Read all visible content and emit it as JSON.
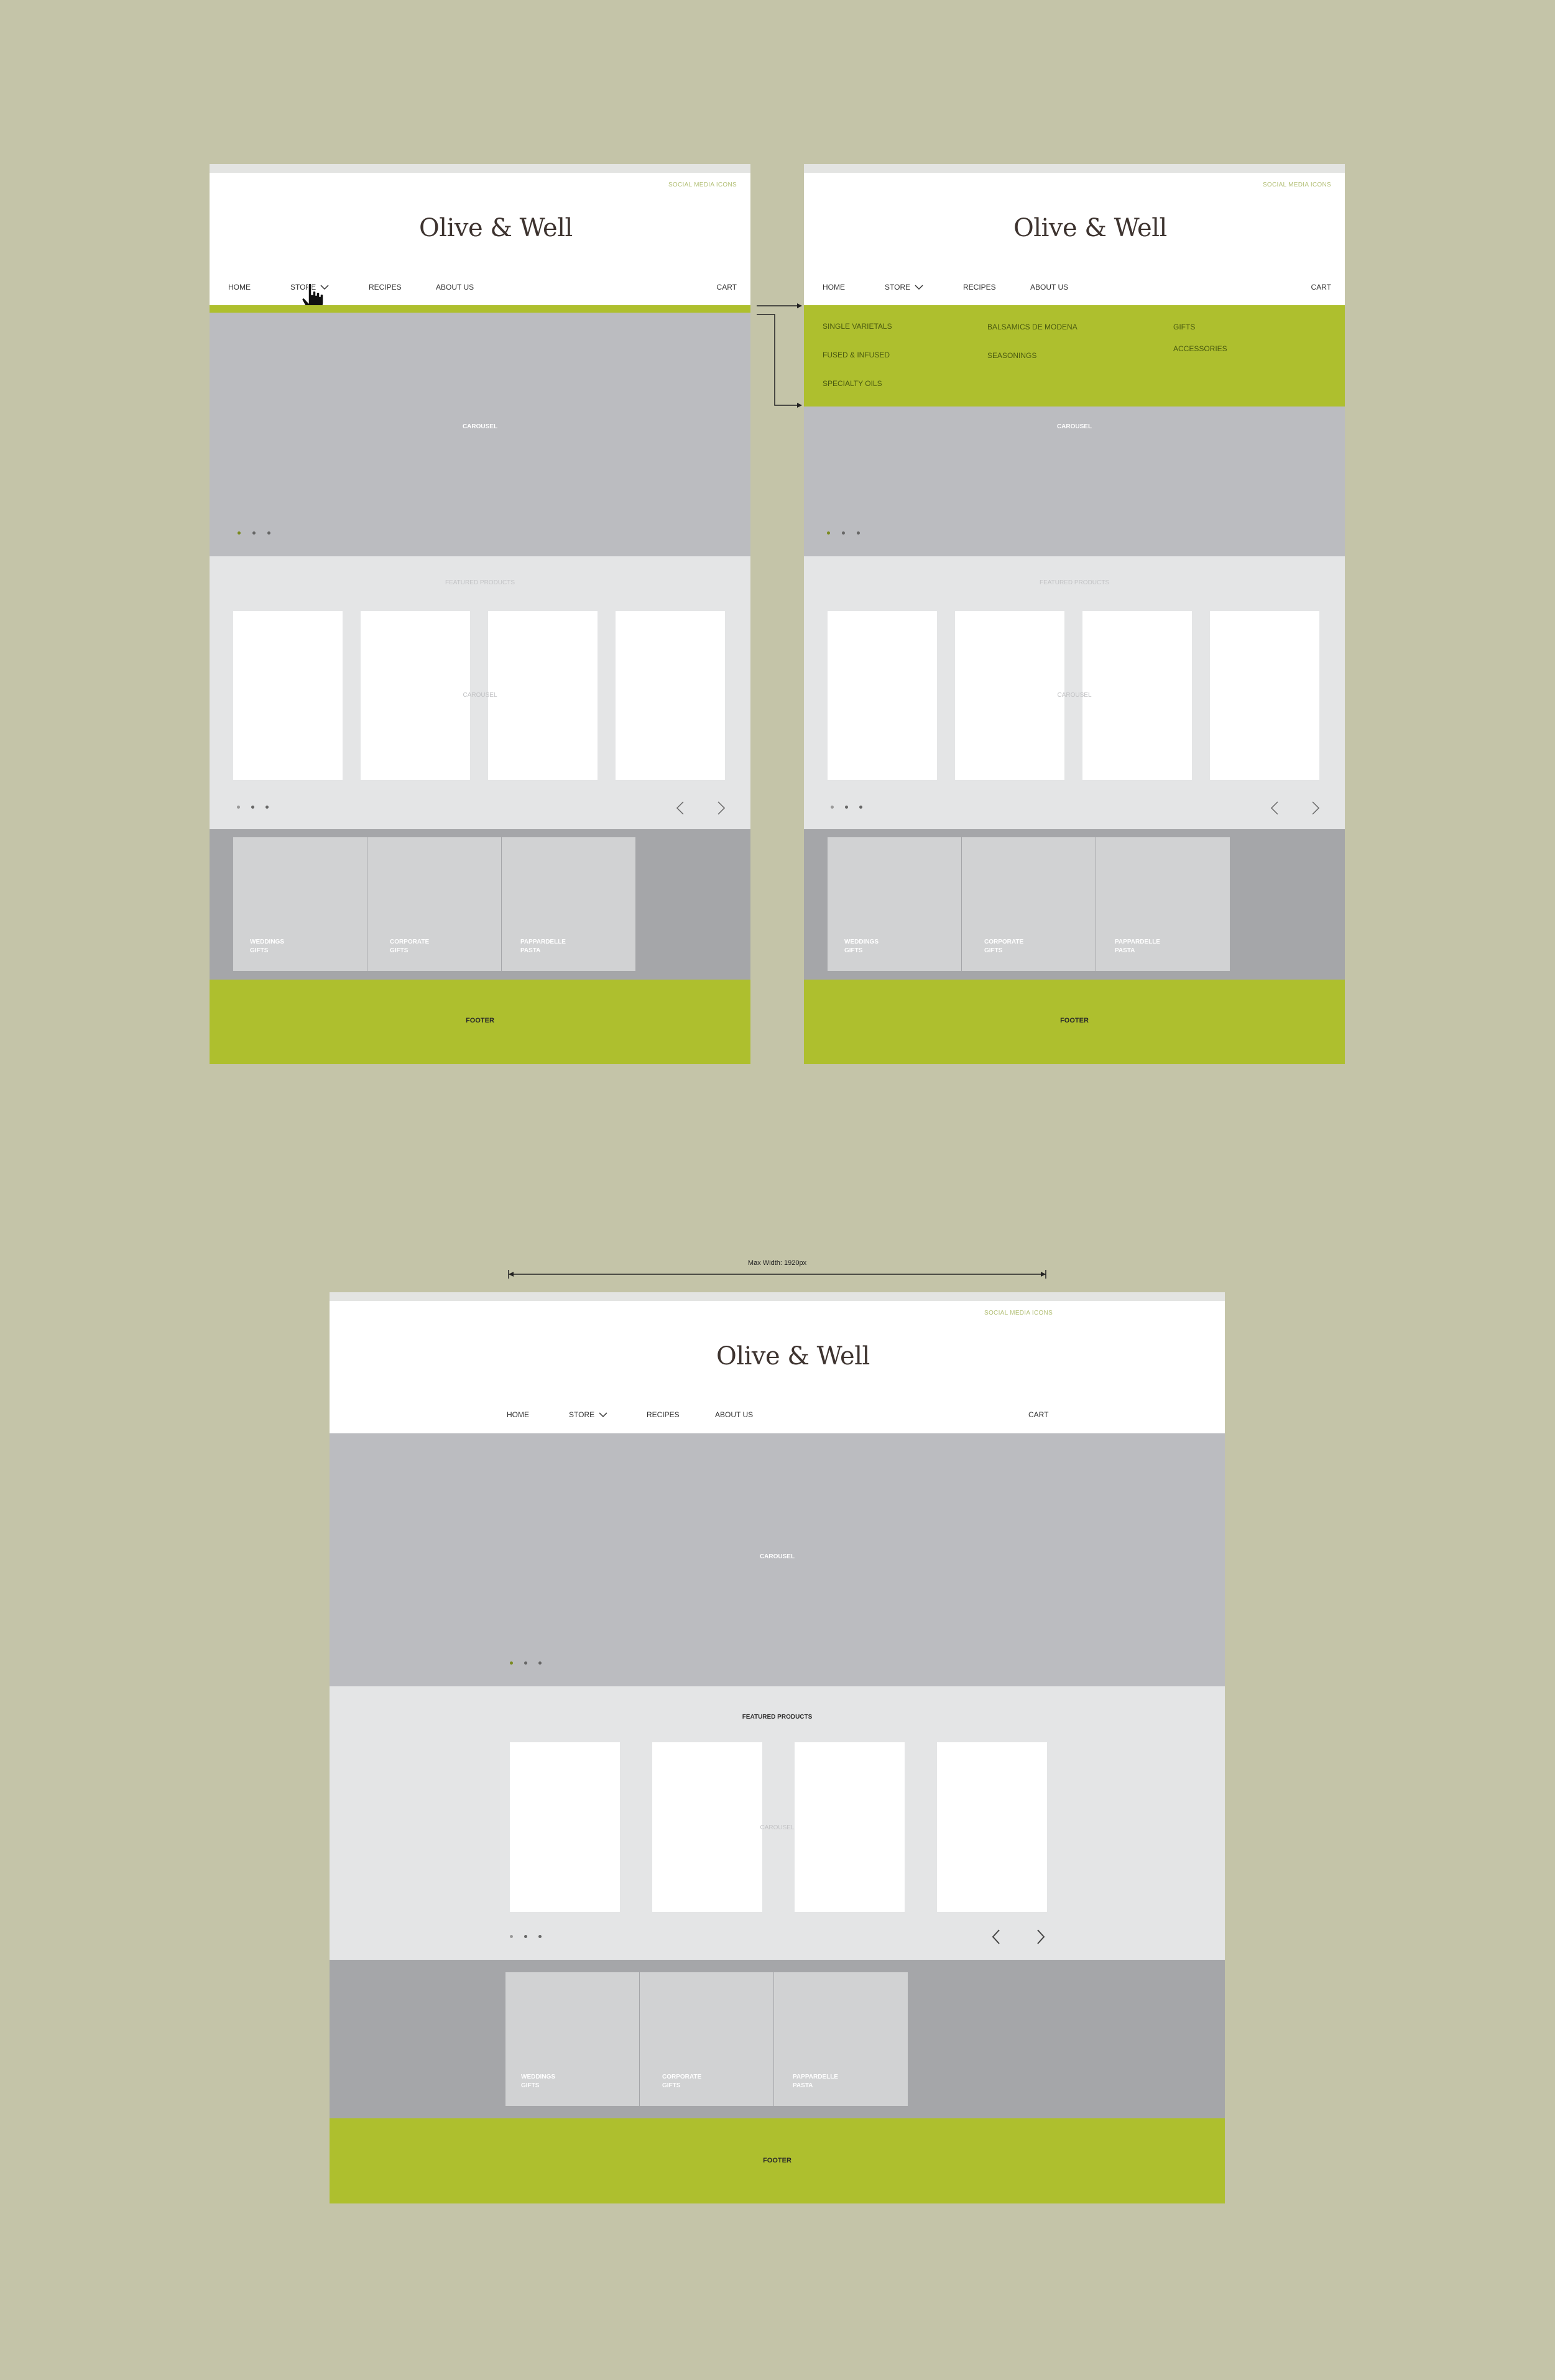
{
  "brand": "Olive & Well",
  "social_label": "SOCIAL MEDIA ICONS",
  "nav": {
    "home": "HOME",
    "store": "STORE",
    "recipes": "RECIPES",
    "about": "ABOUT US",
    "cart": "CART"
  },
  "dropdown": {
    "col1": [
      "SINGLE VARIETALS",
      "FUSED & INFUSED",
      "SPECIALTY OILS"
    ],
    "col2": [
      "BALSAMICS DE MODENA",
      "SEASONINGS"
    ],
    "col3": [
      "GIFTS",
      "ACCESSORIES"
    ]
  },
  "hero_label": "CAROUSEL",
  "featured_title": "FEATURED PRODUCTS",
  "products_carousel_label": "CAROUSEL",
  "gift_tiles": [
    {
      "line1": "WEDDINGS",
      "line2": "GIFTS"
    },
    {
      "line1": "CORPORATE",
      "line2": "GIFTS"
    },
    {
      "line1": "PAPPARDELLE",
      "line2": "PASTA"
    }
  ],
  "footer_label": "FOOTER",
  "max_width_label": "Max Width: 1920px",
  "colors": {
    "background": "#c4c4a8",
    "accent_green": "#aebf2e",
    "hero_gray": "#bbbcc0",
    "featured_gray": "#e4e5e6",
    "gifts_gray": "#a5a6a9"
  }
}
